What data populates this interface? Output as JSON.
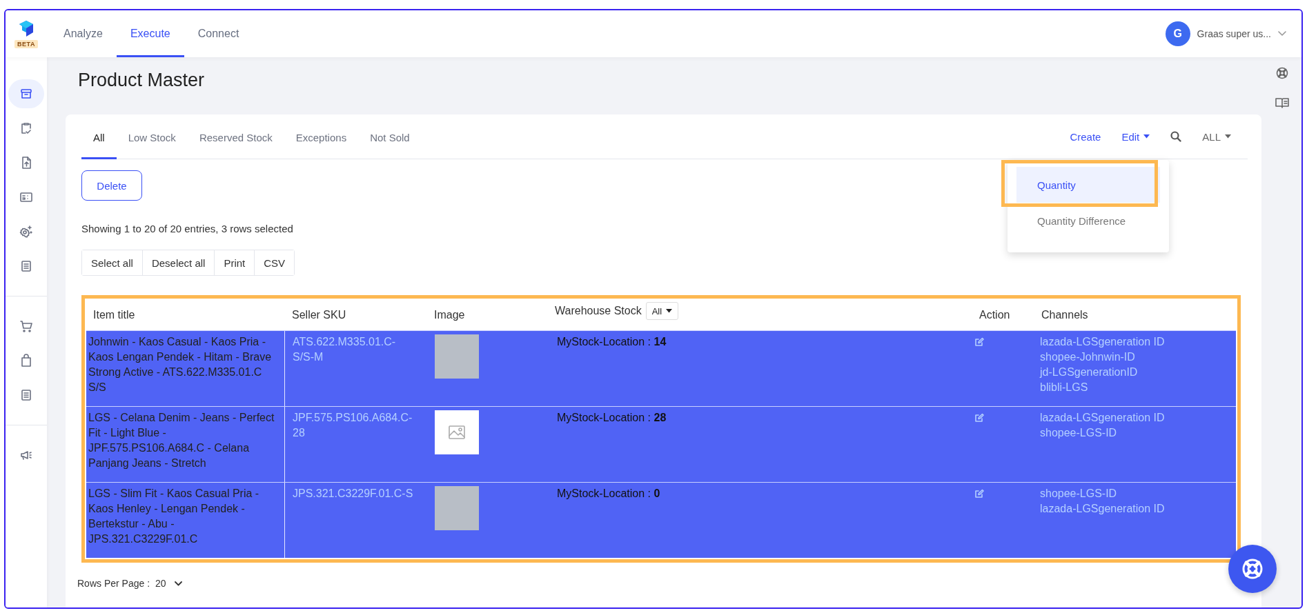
{
  "logo": {
    "badge": "BETA"
  },
  "nav": [
    {
      "label": "Analyze",
      "selected": false
    },
    {
      "label": "Execute",
      "selected": true
    },
    {
      "label": "Connect",
      "selected": false
    }
  ],
  "user": {
    "initial": "G",
    "name": "Graas super us..."
  },
  "sidebar": {
    "groups": [
      {
        "items": [
          {
            "selected": true
          },
          {
            "selected": false
          },
          {
            "selected": false
          },
          {
            "selected": false
          },
          {
            "selected": false
          },
          {
            "selected": false
          }
        ]
      },
      {
        "items": [
          {
            "selected": false
          },
          {
            "selected": false
          },
          {
            "selected": false
          }
        ]
      },
      {
        "items": [
          {
            "selected": false
          }
        ]
      }
    ]
  },
  "page_title": "Product Master",
  "tabs": [
    {
      "label": "All",
      "selected": true
    },
    {
      "label": "Low Stock",
      "selected": false
    },
    {
      "label": "Reserved Stock",
      "selected": false
    },
    {
      "label": "Exceptions",
      "selected": false
    },
    {
      "label": "Not Sold",
      "selected": false
    }
  ],
  "toolbar": {
    "create": "Create",
    "edit": "Edit",
    "filter": "ALL"
  },
  "edit_menu": {
    "items": [
      {
        "label": "Quantity",
        "selected": true,
        "highlighted": true
      },
      {
        "label": "Quantity Difference",
        "selected": false,
        "highlighted": false
      }
    ]
  },
  "delete_button": "Delete",
  "summary": "Showing 1 to 20 of 20 entries, 3 rows selected",
  "export_buttons": [
    "Select all",
    "Deselect all",
    "Print",
    "CSV"
  ],
  "table": {
    "highlighted": true,
    "columns": [
      "Item title",
      "Seller SKU",
      "Image",
      "Warehouse Stock",
      "Action",
      "Channels"
    ],
    "warehouse_filter": "All",
    "rows": [
      {
        "selected": true,
        "item_title": "Johnwin - Kaos Casual - Kaos Pria - Kaos Lengan Pendek - Hitam - Brave Strong Active - ATS.622.M335.01.C S/S",
        "seller_sku": "ATS.622.M335.01.C-S/S-M",
        "image": {
          "kind": "photo"
        },
        "stock": "MyStock-Location : **14**",
        "channels": [
          "lazada-LGSgeneration ID",
          "shopee-Johnwin-ID",
          "jd-LGSgenerationID",
          "blibli-LGS"
        ]
      },
      {
        "selected": true,
        "item_title": "LGS - Celana Denim - Jeans - Perfect Fit - Light Blue - JPF.575.PS106.A684.C - Celana Panjang Jeans - Stretch",
        "seller_sku": "JPF.575.PS106.A684.C-28",
        "image": {
          "kind": "missing"
        },
        "stock": "MyStock-Location : **28**",
        "channels": [
          "lazada-LGSgeneration ID",
          "shopee-LGS-ID"
        ]
      },
      {
        "selected": true,
        "item_title": "LGS - Slim Fit - Kaos Casual Pria - Kaos Henley - Lengan Pendek - Bertekstur - Abu - JPS.321.C3229F.01.C",
        "seller_sku": "JPS.321.C3229F.01.C-S",
        "image": {
          "kind": "photo"
        },
        "stock": "MyStock-Location : **0**",
        "channels": [
          "shopee-LGS-ID",
          "lazada-LGSgeneration ID"
        ]
      }
    ]
  },
  "pagination": {
    "label": "Rows Per Page :",
    "value": "20"
  }
}
